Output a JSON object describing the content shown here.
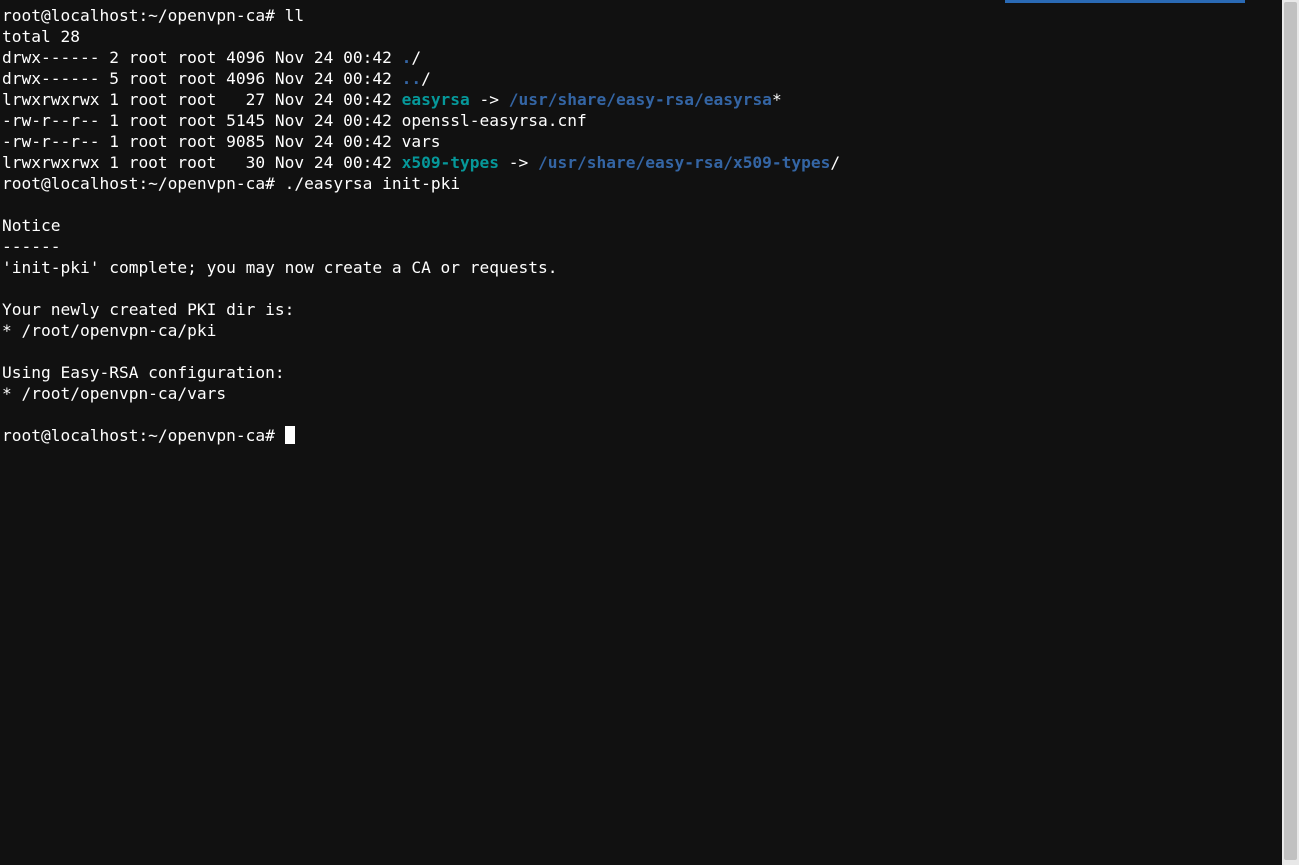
{
  "prompt1": "root@localhost:~/openvpn-ca# ",
  "cmd1": "ll",
  "total_line": "total 28",
  "ls": {
    "l1p": "drwx------ 2 root root 4096 Nov 24 00:42 ",
    "l1n": ".",
    "l1s": "/",
    "l2p": "drwx------ 5 root root 4096 Nov 24 00:42 ",
    "l2n": "..",
    "l2s": "/",
    "l3p": "lrwxrwxrwx 1 root root   27 Nov 24 00:42 ",
    "l3n": "easyrsa",
    "l3arrow": " -> ",
    "l3t": "/usr/share/easy-rsa/easyrsa",
    "l3s": "*",
    "l4": "-rw-r--r-- 1 root root 5145 Nov 24 00:42 openssl-easyrsa.cnf",
    "l5": "-rw-r--r-- 1 root root 9085 Nov 24 00:42 vars",
    "l6p": "lrwxrwxrwx 1 root root   30 Nov 24 00:42 ",
    "l6n": "x509-types",
    "l6arrow": " -> ",
    "l6t": "/usr/share/easy-rsa/x509-types",
    "l6s": "/"
  },
  "prompt2": "root@localhost:~/openvpn-ca# ",
  "cmd2": "./easyrsa init-pki",
  "out": {
    "notice_hdr": "Notice",
    "notice_rule": "------",
    "notice_msg": "'init-pki' complete; you may now create a CA or requests.",
    "pki_hdr": "Your newly created PKI dir is:",
    "pki_path": "* /root/openvpn-ca/pki",
    "cfg_hdr": "Using Easy-RSA configuration:",
    "cfg_path": "* /root/openvpn-ca/vars"
  },
  "prompt3": "root@localhost:~/openvpn-ca# "
}
